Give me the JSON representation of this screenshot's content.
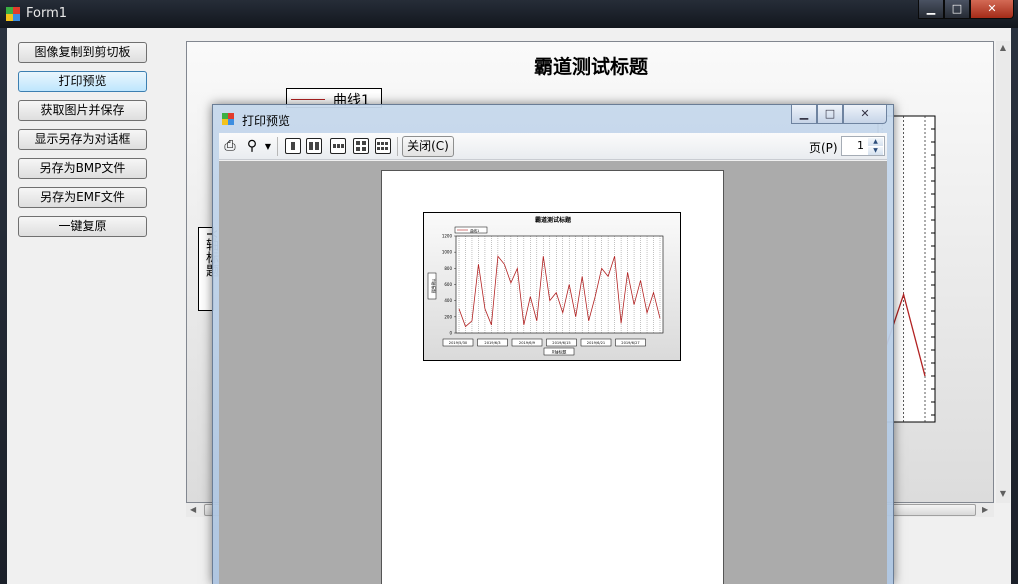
{
  "window": {
    "title": "Form1",
    "caption": {
      "minimize": "▁",
      "maximize": "□",
      "close": "✕"
    }
  },
  "buttons": [
    {
      "label": "图像复制到剪切板"
    },
    {
      "label": "打印预览"
    },
    {
      "label": "获取图片并保存"
    },
    {
      "label": "显示另存为对话框"
    },
    {
      "label": "另存为BMP文件"
    },
    {
      "label": "另存为EMF文件"
    },
    {
      "label": "一键复原"
    }
  ],
  "chart": {
    "title": "霸道测试标题",
    "legend": "曲线1",
    "ylabel": "Y轴标题",
    "line_color": "#b22222"
  },
  "preview": {
    "title": "打印预览",
    "caption": {
      "minimize": "▁",
      "maximize": "□",
      "close": "✕"
    },
    "toolbar": {
      "print_icon": "printer-icon",
      "zoom_icon": "magnifier-icon",
      "close_label": "关闭(C)",
      "page_label": "页(P)",
      "page_value": "1"
    },
    "mini_chart": {
      "title": "霸道测试标题",
      "legend": "曲线1",
      "ylabel": "Y轴标题",
      "xlabel": "X轴标题",
      "y_ticks": [
        "0",
        "200",
        "400",
        "600",
        "800",
        "1000",
        "1200"
      ],
      "x_ticks": [
        "2019/5/30",
        "2019/6/3",
        "2019/6/9",
        "2019/6/15",
        "2019/6/21",
        "2019/6/27"
      ]
    }
  },
  "chart_data": {
    "type": "line",
    "title": "霸道测试标题",
    "xlabel": "X轴标题",
    "ylabel": "Y轴标题",
    "ylim": [
      0,
      1200
    ],
    "series": [
      {
        "name": "曲线1",
        "x": [
          "2019/5/30",
          "2019/5/31",
          "2019/6/1",
          "2019/6/2",
          "2019/6/3",
          "2019/6/4",
          "2019/6/5",
          "2019/6/6",
          "2019/6/7",
          "2019/6/8",
          "2019/6/9",
          "2019/6/10",
          "2019/6/11",
          "2019/6/12",
          "2019/6/13",
          "2019/6/14",
          "2019/6/15",
          "2019/6/16",
          "2019/6/17",
          "2019/6/18",
          "2019/6/19",
          "2019/6/20",
          "2019/6/21",
          "2019/6/22",
          "2019/6/23",
          "2019/6/24",
          "2019/6/25",
          "2019/6/26",
          "2019/6/27",
          "2019/6/28",
          "2019/6/29",
          "2019/6/30"
        ],
        "values": [
          300,
          80,
          150,
          850,
          300,
          100,
          950,
          850,
          620,
          800,
          100,
          450,
          150,
          950,
          400,
          500,
          250,
          600,
          200,
          700,
          150,
          450,
          800,
          700,
          950,
          120,
          750,
          350,
          650,
          250,
          500,
          180
        ]
      }
    ]
  }
}
